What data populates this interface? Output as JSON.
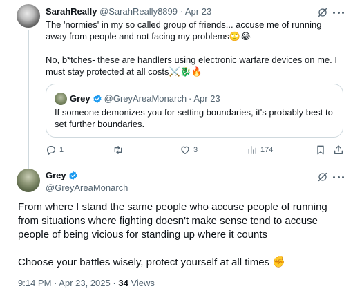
{
  "tweet": {
    "author_name": "SarahReally",
    "author_handle": "@SarahReally8899",
    "separator": "·",
    "date": "Apr 23",
    "text_line1": "The 'normies' in my so called group of friends... accuse me of running away from people and not facing my problems🙄😂",
    "text_line2": "No, b*tches- these are handlers using electronic warfare devices on me. I must stay protected at all costs⚔️🐉🔥",
    "quote": {
      "author_name": "Grey",
      "author_handle": "@GreyAreaMonarch",
      "separator": "·",
      "date": "Apr 23",
      "text": "If someone demonizes you for setting boundaries, it's probably best to set further boundaries."
    },
    "actions": {
      "replies": "1",
      "reposts": "",
      "likes": "3",
      "views": "174"
    }
  },
  "main_tweet": {
    "author_name": "Grey",
    "author_handle": "@GreyAreaMonarch",
    "paragraph1": "From where I stand the same people who accuse people of running from situations where fighting doesn't make sense tend to accuse people of being vicious for standing up where it counts",
    "paragraph2": "Choose your battles wisely, protect yourself at all times ✊",
    "time": "9:14 PM",
    "separator": "·",
    "date": "Apr 23, 2025",
    "views_count": "34",
    "views_label": "Views"
  },
  "colors": {
    "text_primary": "#0f1419",
    "text_secondary": "#536471",
    "verified_blue": "#1d9bf0",
    "border": "#cfd9de"
  },
  "icons": [
    "grok-icon",
    "more-icon",
    "verified-icon",
    "reply-icon",
    "repost-icon",
    "like-icon",
    "views-icon",
    "bookmark-icon",
    "share-icon"
  ]
}
